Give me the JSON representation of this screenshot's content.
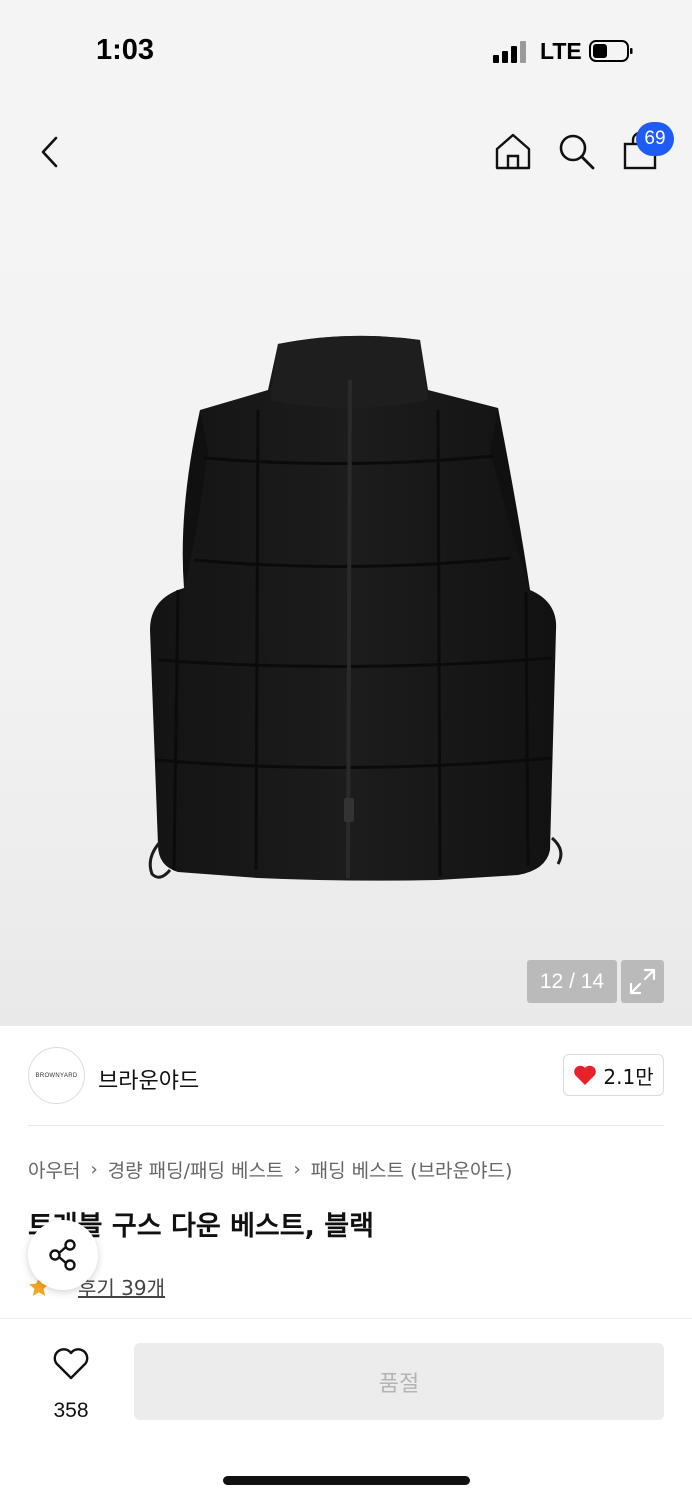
{
  "status_bar": {
    "time": "1:03",
    "network": "LTE"
  },
  "nav": {
    "cart_count": "69"
  },
  "gallery": {
    "counter": "12 / 14"
  },
  "brand": {
    "logo_text": "BROWNYARD",
    "name": "브라운야드",
    "likes": "2.1만"
  },
  "breadcrumb": [
    "아우터",
    "경량 패딩/패딩 베스트",
    "패딩 베스트 (브라운야드)"
  ],
  "product": {
    "title": "트래블 구스 다운 베스트, 블랙",
    "review_link": "후기 39개"
  },
  "bottom": {
    "wish_count": "358",
    "buy_button": "품절"
  },
  "colors": {
    "accent": "#1f5cf5",
    "heart": "#e8212b",
    "star": "#f5a623"
  }
}
